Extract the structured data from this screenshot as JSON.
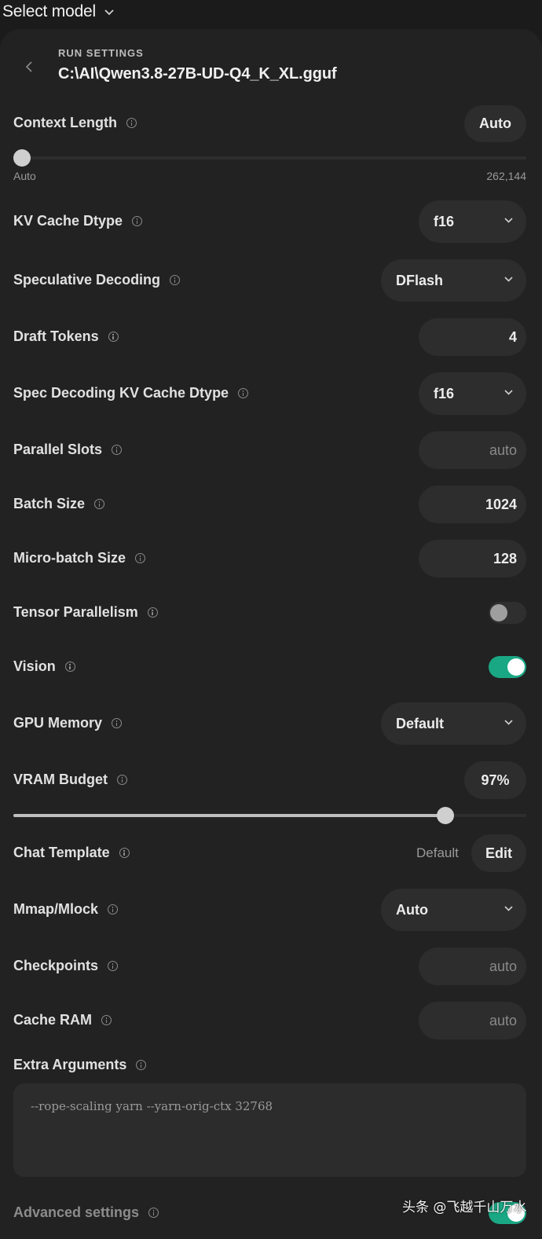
{
  "topbar": {
    "title": "Select model"
  },
  "run": {
    "section_label": "RUN SETTINGS",
    "file": "C:\\AI\\Qwen3.8-27B-UD-Q4_K_XL.gguf"
  },
  "context_length": {
    "label": "Context Length",
    "value": "Auto",
    "slider_min": "Auto",
    "slider_max": "262,144",
    "slider_level": 0
  },
  "kv_cache_dtype": {
    "label": "KV Cache Dtype",
    "value": "f16"
  },
  "speculative_decoding": {
    "label": "Speculative Decoding",
    "value": "DFlash"
  },
  "draft_tokens": {
    "label": "Draft Tokens",
    "value": "4"
  },
  "spec_kv_cache_dtype": {
    "label": "Spec Decoding KV Cache Dtype",
    "value": "f16"
  },
  "parallel_slots": {
    "label": "Parallel Slots",
    "placeholder": "auto"
  },
  "batch_size": {
    "label": "Batch Size",
    "value": "1024"
  },
  "micro_batch_size": {
    "label": "Micro-batch Size",
    "value": "128"
  },
  "tensor_parallelism": {
    "label": "Tensor Parallelism",
    "enabled": false
  },
  "vision": {
    "label": "Vision",
    "enabled": true
  },
  "gpu_memory": {
    "label": "GPU Memory",
    "value": "Default"
  },
  "vram_budget": {
    "label": "VRAM Budget",
    "value": "97%",
    "slider_level": 0.842
  },
  "chat_template": {
    "label": "Chat Template",
    "current": "Default",
    "edit_label": "Edit"
  },
  "mmap_mlock": {
    "label": "Mmap/Mlock",
    "value": "Auto"
  },
  "checkpoints": {
    "label": "Checkpoints",
    "placeholder": "auto"
  },
  "cache_ram": {
    "label": "Cache RAM",
    "placeholder": "auto"
  },
  "extra_arguments": {
    "label": "Extra Arguments",
    "value": "--rope-scaling yarn --yarn-orig-ctx 32768"
  },
  "advanced_settings": {
    "label": "Advanced settings",
    "enabled": true
  },
  "watermark": "头条 @飞越千山万水",
  "colors": {
    "toggle_on": "#1aa784",
    "panel": "#222222",
    "background": "#1b1b1b"
  }
}
